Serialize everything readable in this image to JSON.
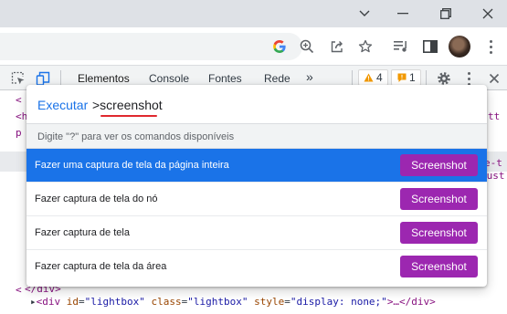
{
  "browser": {
    "window_controls": [
      "chevron-down-icon",
      "minimize-icon",
      "restore-icon",
      "close-icon"
    ],
    "toolbar_icons": [
      "google-lens-icon",
      "zoom-icon",
      "share-icon",
      "star-icon",
      "media-controls-icon",
      "side-panel-icon",
      "profile-avatar",
      "menu-icon"
    ]
  },
  "devtools": {
    "tabs": [
      {
        "label": "Elementos",
        "active": true
      },
      {
        "label": "Console",
        "active": false
      },
      {
        "label": "Fontes",
        "active": false
      },
      {
        "label": "Rede",
        "active": false
      }
    ],
    "more_tabs": "»",
    "warnings_count": "4",
    "issues_count": "1",
    "accent_color": "#1a73e8"
  },
  "elements_panel": {
    "gutter_chars": [
      "<",
      "<h",
      "p",
      "<",
      "<"
    ],
    "right_fragments": [
      "tt",
      "e-t",
      "cust"
    ],
    "lightbox_line": {
      "tag_open": "<div",
      "attr1_name": "id",
      "attr1_value": "\"lightbox\"",
      "attr2_name": "class",
      "attr2_value": "\"lightbox\"",
      "attr3_name": "style",
      "attr3_value": "\"display: none;\"",
      "tail": ">…</div>"
    },
    "closing_line": "</div>"
  },
  "command_menu": {
    "prefix": "Executar",
    "query": ">screenshot",
    "hint": "Digite \"?\" para ver os comandos disponíveis",
    "items": [
      {
        "label": "Fazer uma captura de tela da página inteira",
        "button": "Screenshot",
        "selected": true
      },
      {
        "label": "Fazer captura de tela do nó",
        "button": "Screenshot",
        "selected": false
      },
      {
        "label": "Fazer captura de tela",
        "button": "Screenshot",
        "selected": false
      },
      {
        "label": "Fazer captura de tela da área",
        "button": "Screenshot",
        "selected": false
      }
    ],
    "button_color": "#9c27b0",
    "selected_color": "#1a73e8"
  }
}
